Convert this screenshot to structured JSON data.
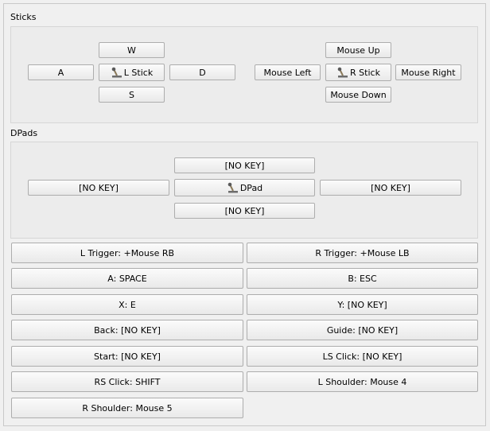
{
  "sticks": {
    "title": "Sticks",
    "left": {
      "up": "W",
      "left": "A",
      "center": "L Stick",
      "right": "D",
      "down": "S"
    },
    "right": {
      "up": "Mouse Up",
      "left": "Mouse Left",
      "center": "R Stick",
      "right": "Mouse Right",
      "down": "Mouse Down"
    }
  },
  "dpads": {
    "title": "DPads",
    "up": "[NO KEY]",
    "left": "[NO KEY]",
    "center": "DPad",
    "right": "[NO KEY]",
    "down": "[NO KEY]"
  },
  "bindings": [
    "L Trigger: +Mouse RB",
    "R Trigger: +Mouse LB",
    "A: SPACE",
    "B: ESC",
    "X: E",
    "Y: [NO KEY]",
    "Back: [NO KEY]",
    "Guide: [NO KEY]",
    "Start: [NO KEY]",
    "LS Click: [NO KEY]",
    "RS Click: SHIFT",
    "L Shoulder: Mouse 4",
    "R Shoulder: Mouse 5"
  ],
  "icons": {
    "stick": "joystick-icon",
    "dpad": "dpad-icon"
  }
}
